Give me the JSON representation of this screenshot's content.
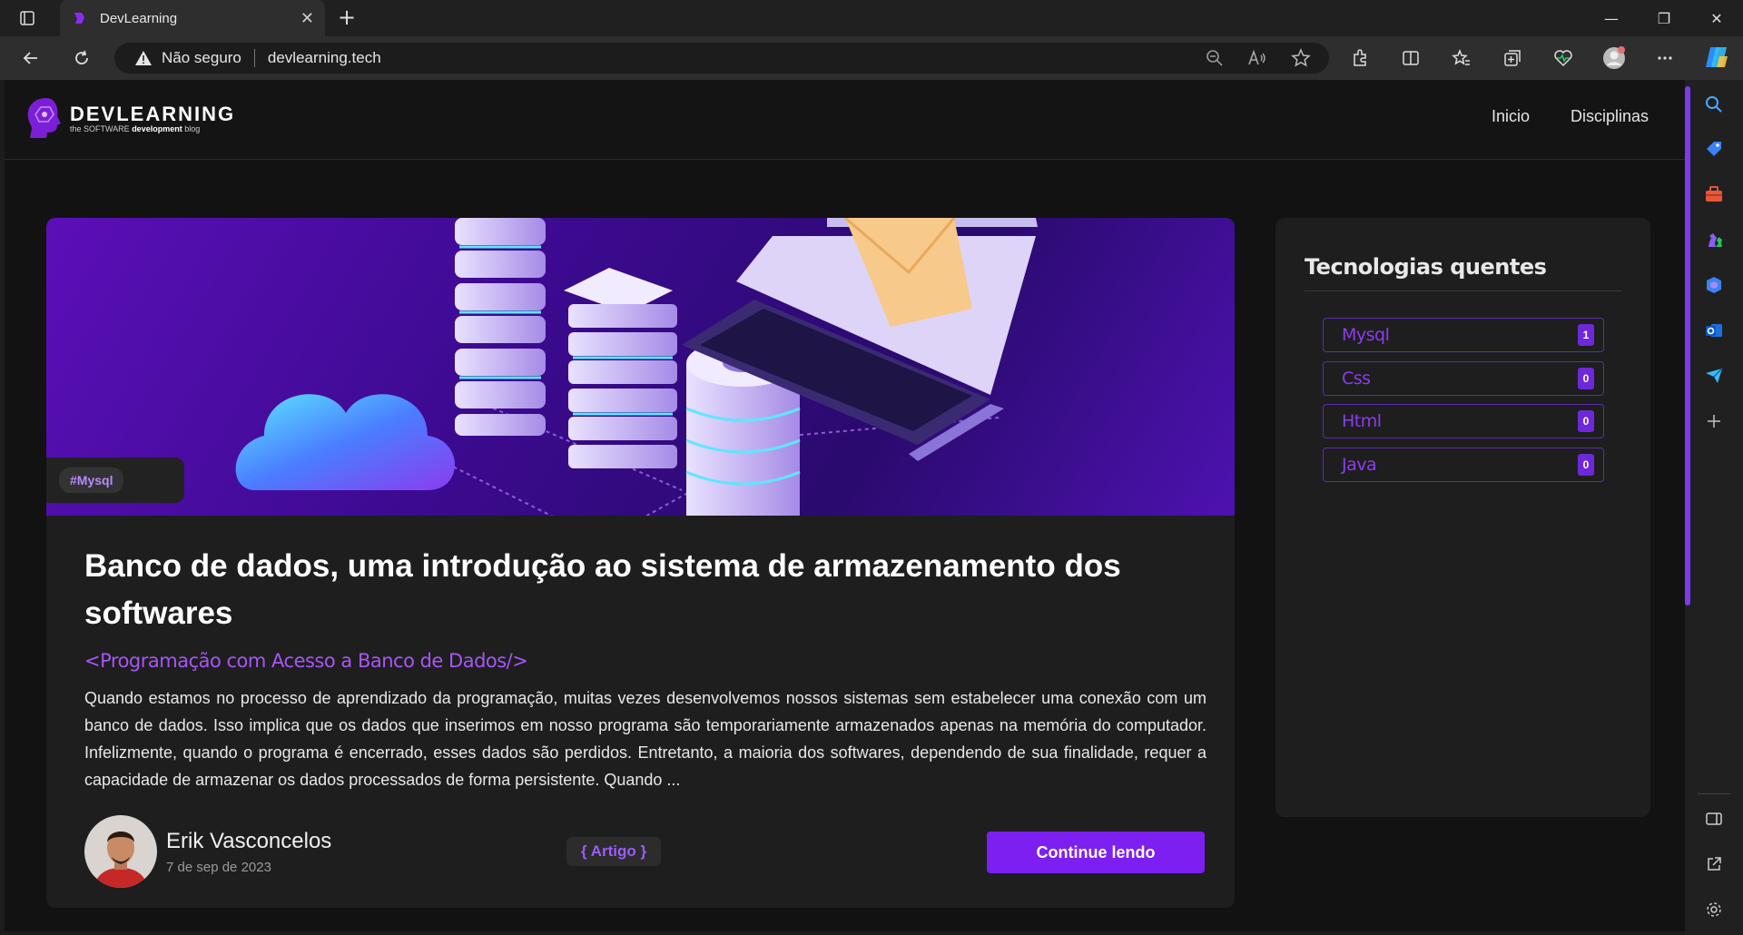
{
  "browser": {
    "tab_title": "DevLearning",
    "security_label": "Não seguro",
    "url": "devlearning.tech"
  },
  "site": {
    "logo_title": "DEVLEARNING",
    "logo_sub_prefix": "the SOFTWARE ",
    "logo_sub_bold": "development",
    "logo_sub_suffix": " blog",
    "nav": [
      "Inicio",
      "Disciplinas"
    ]
  },
  "article": {
    "hashtag": "#Mysql",
    "title": "Banco de dados, uma introdução ao sistema de armazenamento dos softwares",
    "discipline": "<Programação com Acesso a Banco de Dados/>",
    "excerpt": "Quando estamos no processo de aprendizado da programação, muitas vezes desenvolvemos nossos sistemas sem estabelecer uma conexão com um banco de dados. Isso implica que os dados que inserimos em nosso programa são temporariamente armazenados apenas na memória do computador. Infelizmente, quando o programa é encerrado, esses dados são perdidos. Entretanto, a maioria dos softwares, dependendo de sua finalidade, requer a capacidade de armazenar os dados processados de forma persistente. Quando ...",
    "author_name": "Erik Vasconcelos",
    "date": "7 de sep de 2023",
    "type": "{ Artigo }",
    "cta": "Continue lendo"
  },
  "sidebar": {
    "title": "Tecnologias quentes",
    "items": [
      {
        "name": "Mysql",
        "count": "1"
      },
      {
        "name": "Css",
        "count": "0"
      },
      {
        "name": "Html",
        "count": "0"
      },
      {
        "name": "Java",
        "count": "0"
      }
    ]
  },
  "colors": {
    "accent": "#7c1ff0",
    "tech_text": "#8b3cf0",
    "background": "#121212",
    "card": "#1e1e1e"
  }
}
